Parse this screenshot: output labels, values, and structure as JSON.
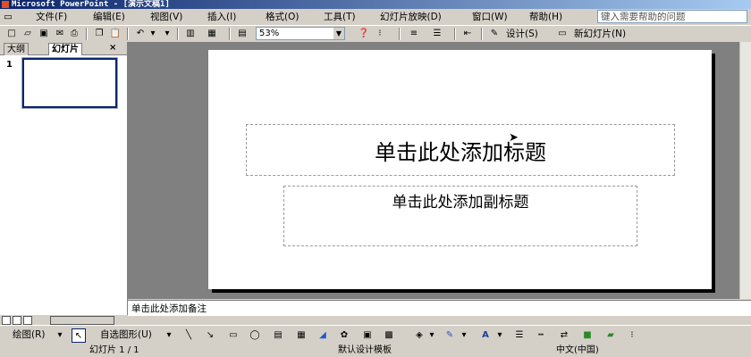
{
  "titlebar": {
    "title": "Microsoft PowerPoint - [演示文稿1]"
  },
  "menubar": {
    "items": [
      "文件(F)",
      "编辑(E)",
      "视图(V)",
      "插入(I)",
      "格式(O)",
      "工具(T)",
      "幻灯片放映(D)",
      "窗口(W)",
      "帮助(H)"
    ],
    "help_placeholder": "键入需要帮助的问题"
  },
  "toolbar": {
    "zoom": "53%",
    "design_label": "设计(S)",
    "new_slide_label": "新幻灯片(N)"
  },
  "leftpanel": {
    "tabs": [
      "大纲",
      "幻灯片"
    ],
    "close_label": "×",
    "slide_number": "1"
  },
  "slide": {
    "title_placeholder": "单击此处添加标题",
    "subtitle_placeholder": "单击此处添加副标题"
  },
  "notes": {
    "placeholder": "单击此处添加备注"
  },
  "drawbar": {
    "draw_label": "绘图(R)",
    "autoshapes_label": "自选图形(U)"
  },
  "statusbar": {
    "slide_info": "幻灯片 1 / 1",
    "template": "默认设计模板",
    "language": "中文(中国)"
  },
  "colors": {
    "title_bar": "#0a246a",
    "selection": "#0a246a",
    "workspace": "#808080"
  }
}
